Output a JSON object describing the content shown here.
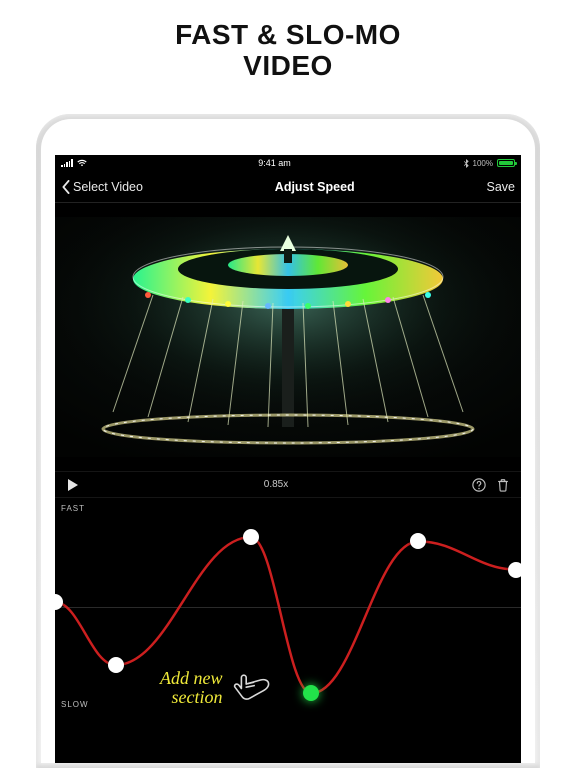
{
  "hero": {
    "line1": "FAST & SLO-MO",
    "line2": "VIDEO"
  },
  "status": {
    "time": "9:41 am",
    "battery_pct": "100%"
  },
  "nav": {
    "back": "Select Video",
    "title": "Adjust Speed",
    "save": "Save"
  },
  "controls": {
    "speed_value": "0.85x"
  },
  "editor": {
    "axis_fast": "FAST",
    "axis_slow": "SLOW",
    "points": [
      {
        "x": 0.0,
        "y": 0.48
      },
      {
        "x": 0.13,
        "y": 0.77
      },
      {
        "x": 0.42,
        "y": 0.18
      },
      {
        "x": 0.55,
        "y": 0.9,
        "active": true
      },
      {
        "x": 0.78,
        "y": 0.2
      },
      {
        "x": 0.99,
        "y": 0.33
      }
    ],
    "annotation": {
      "line1": "Add new",
      "line2": "section"
    }
  }
}
